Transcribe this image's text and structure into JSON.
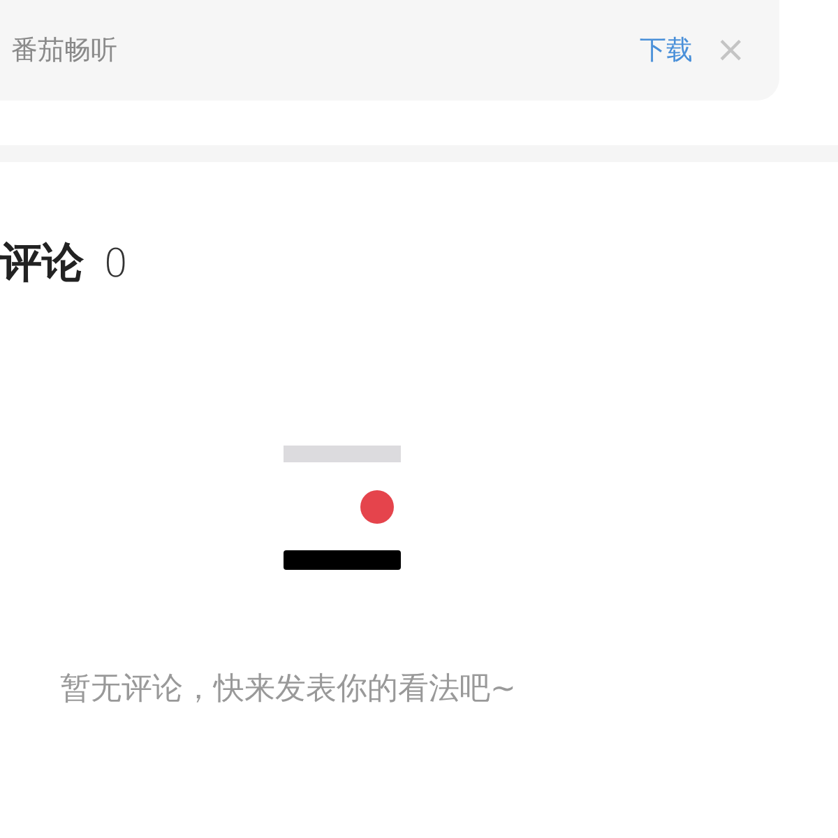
{
  "app_banner": {
    "app_name": "番茄畅听",
    "action": "下载",
    "close": "×"
  },
  "comments": {
    "title": "评论",
    "count": "0",
    "empty_message": "暂无评论，快来发表你的看法吧~"
  }
}
